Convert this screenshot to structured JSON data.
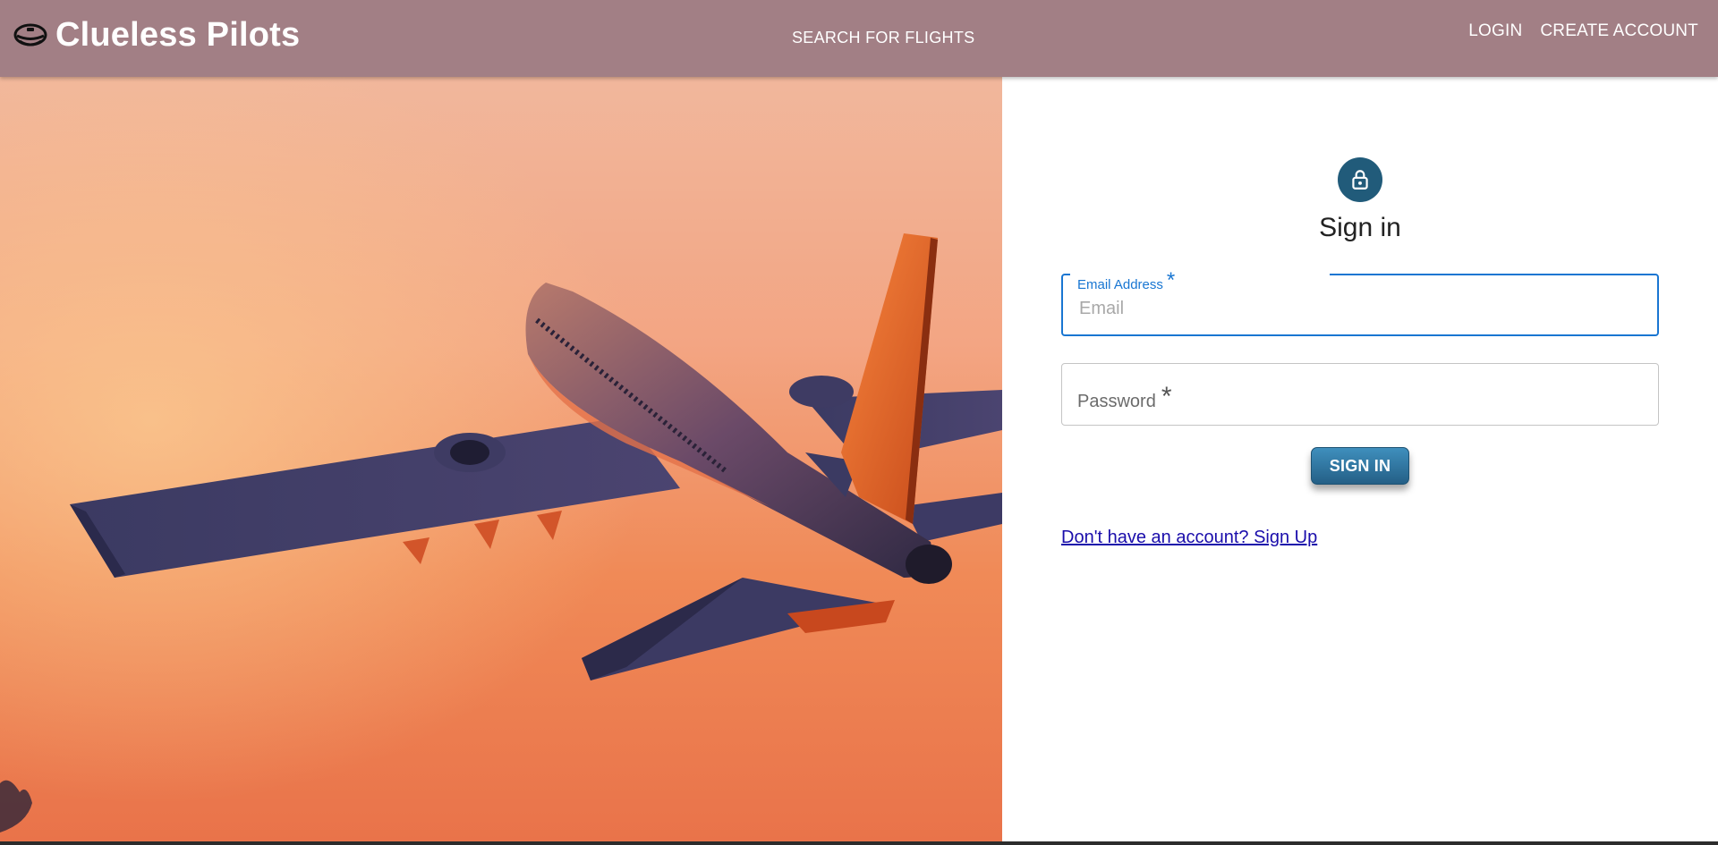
{
  "header": {
    "brand_icon": "pilot-cap-icon",
    "brand_title": "Clueless Pilots",
    "nav_center": "SEARCH FOR FLIGHTS",
    "nav_right": [
      "LOGIN",
      "CREATE ACCOUNT"
    ]
  },
  "hero": {
    "image": "airplane-sunset-photo"
  },
  "form": {
    "avatar_icon": "lock-icon",
    "title": "Sign in",
    "email": {
      "label": "Email Address",
      "required_mark": "*",
      "placeholder": "Email",
      "value": ""
    },
    "password": {
      "label": "Password",
      "required_mark": "*"
    },
    "submit_label": "SIGN IN",
    "signup_link": "Don't have an account? Sign Up"
  },
  "colors": {
    "header_bg": "#a27f85",
    "avatar_bg": "#215b7a",
    "focus_blue": "#1976d2",
    "button_top": "#3f8fbd",
    "button_bottom": "#245f86",
    "link": "#1a0dab"
  }
}
